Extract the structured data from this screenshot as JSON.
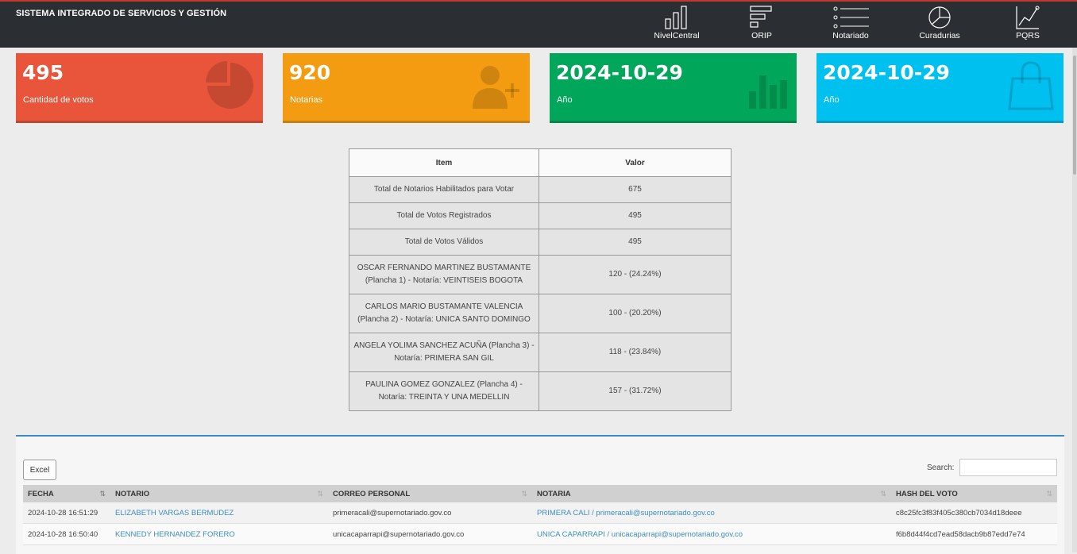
{
  "app": {
    "title": "SISTEMA INTEGRADO DE SERVICIOS Y GESTIÓN"
  },
  "nav": [
    {
      "label": "NivelCentral",
      "icon": "bar-chart-icon"
    },
    {
      "label": "ORIP",
      "icon": "list-blocks-icon"
    },
    {
      "label": "Notariado",
      "icon": "list-icon"
    },
    {
      "label": "Curadurias",
      "icon": "pie-chart-icon"
    },
    {
      "label": "PQRS",
      "icon": "line-chart-icon"
    }
  ],
  "cards": [
    {
      "value": "495",
      "label": "Cantidad de votos",
      "color": "#e8553a",
      "icon": "pie-chart-icon"
    },
    {
      "value": "920",
      "label": "Notarias",
      "color": "#f39c12",
      "icon": "user-add-icon"
    },
    {
      "value": "2024-10-29",
      "label": "Año",
      "color": "#00a65a",
      "icon": "bar-chart-icon"
    },
    {
      "value": "2024-10-29",
      "label": "Año",
      "color": "#00c0ef",
      "icon": "shopping-bag-icon"
    }
  ],
  "results": {
    "headers": [
      "Item",
      "Valor"
    ],
    "rows": [
      {
        "item": "Total de Notarios Habilitados para Votar",
        "value": "675"
      },
      {
        "item": "Total de Votos Registrados",
        "value": "495"
      },
      {
        "item": "Total de Votos Válidos",
        "value": "495"
      },
      {
        "item_l1": "OSCAR FERNANDO MARTINEZ BUSTAMANTE",
        "item_l2": "(Plancha 1) - Notaría: VEINTISEIS BOGOTA",
        "value": "120 - (24.24%)"
      },
      {
        "item_l1": "CARLOS MARIO BUSTAMANTE VALENCIA",
        "item_l2": "(Plancha 2) - Notaría: UNICA SANTO DOMINGO",
        "value": "100 - (20.20%)"
      },
      {
        "item_l1": "ANGELA YOLIMA SANCHEZ ACUÑA (Plancha 3) -",
        "item_l2": "Notaría: PRIMERA SAN GIL",
        "value": "118 - (23.84%)"
      },
      {
        "item_l1": "PAULINA GOMEZ GONZALEZ (Plancha 4) -",
        "item_l2": "Notaría: TREINTA Y UNA MEDELLIN",
        "value": "157 - (31.72%)"
      }
    ]
  },
  "datatable": {
    "excel_label": "Excel",
    "search_label": "Search:",
    "search_value": "",
    "columns": [
      "FECHA",
      "NOTARIO",
      "CORREO PERSONAL",
      "NOTARIA",
      "HASH DEL VOTO"
    ],
    "rows": [
      {
        "fecha": "2024-10-28 16:51:29",
        "notario": "ELIZABETH VARGAS BERMUDEZ",
        "correo": "primeracali@supernotariado.gov.co",
        "notaria": "PRIMERA CALI / primeracali@supernotariado.gov.co",
        "hash": "c8c25fc3f83f405c380cb7034d18deee"
      },
      {
        "fecha": "2024-10-28 16:50:40",
        "notario": "KENNEDY HERNANDEZ FORERO",
        "correo": "unicacaparrapi@supernotariado.gov.co",
        "notaria": "UNICA CAPARRAPI / unicacaparrapi@supernotariado.gov.co",
        "hash": "f6b8d44f4cd7ead58dacb9b87edd7e74"
      }
    ]
  }
}
